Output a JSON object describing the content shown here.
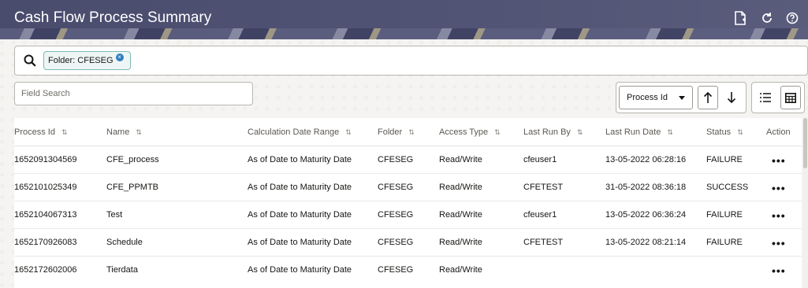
{
  "header": {
    "title": "Cash Flow Process Summary",
    "icons": [
      "export-icon",
      "refresh-icon",
      "help-icon"
    ]
  },
  "search": {
    "chip_label": "Folder: CFESEG",
    "field_search_placeholder": "Field Search"
  },
  "sort": {
    "selected": "Process Id"
  },
  "table": {
    "columns": [
      "Process Id",
      "Name",
      "Calculation Date Range",
      "Folder",
      "Access Type",
      "Last Run By",
      "Last Run Date",
      "Status",
      "Action"
    ],
    "rows": [
      [
        "1652091304569",
        "CFE_process",
        "As of Date to Maturity Date",
        "CFESEG",
        "Read/Write",
        "cfeuser1",
        "13-05-2022 06:28:16",
        "FAILURE"
      ],
      [
        "1652101025349",
        "CFE_PPMTB",
        "As of Date to Maturity Date",
        "CFESEG",
        "Read/Write",
        "CFETEST",
        "31-05-2022 08:36:18",
        "SUCCESS"
      ],
      [
        "1652104067313",
        "Test",
        "As of Date to Maturity Date",
        "CFESEG",
        "Read/Write",
        "cfeuser1",
        "13-05-2022 06:36:24",
        "FAILURE"
      ],
      [
        "1652170926083",
        "Schedule",
        "As of Date to Maturity Date",
        "CFESEG",
        "Read/Write",
        "CFETEST",
        "13-05-2022 08:21:14",
        "FAILURE"
      ],
      [
        "1652172602006",
        "Tierdata",
        "As of Date to Maturity Date",
        "CFESEG",
        "Read/Write",
        "",
        "",
        ""
      ]
    ],
    "action_glyph": "•••"
  },
  "colors": {
    "header_bg": "#4a4c6e",
    "chip_border": "#7fb9b2",
    "chip_close": "#2f7fc1"
  }
}
